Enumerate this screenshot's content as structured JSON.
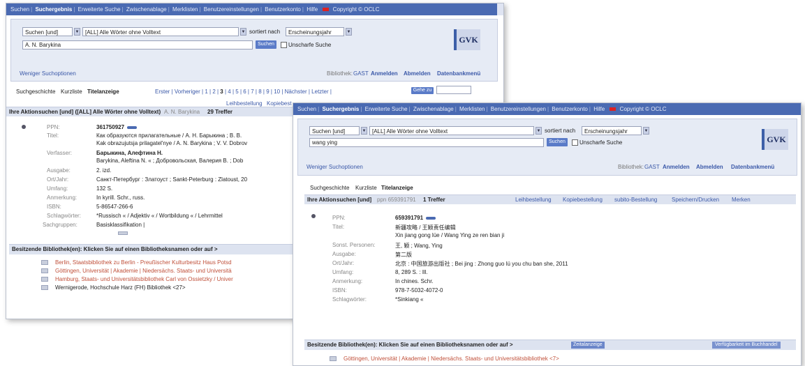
{
  "w1": {
    "nav": [
      "Suchen",
      "Suchergebnis",
      "Erweiterte Suche",
      "Zwischenablage",
      "Merklisten",
      "Benutzereinstellungen",
      "Benutzerkonto",
      "Hilfe"
    ],
    "copyright": "Copyright © OCLC",
    "search_mode": "Suchen [und]",
    "search_index": "[ALL] Alle Wörter ohne Volltext",
    "sort_label": "sortiert nach",
    "sort_value": "Erscheinungsjahr",
    "query": "A. N. Barykina",
    "search_button": "Suchen",
    "fuzzy_label": "Unscharfe Suche",
    "logo": "GVK",
    "fewer_options": "Weniger Suchoptionen",
    "library_label": "Bibliothek:",
    "library_value": "GAST",
    "login": "Anmelden",
    "logout": "Abmelden",
    "db_menu": "Datenbankmenü",
    "tab_history": "Suchgeschichte",
    "tab_short": "Kurzliste",
    "tab_title": "Titelanzeige",
    "pager_first": "Erster",
    "pager_prev": "Vorheriger",
    "pages": [
      "1",
      "2",
      "3",
      "4",
      "5",
      "6",
      "7",
      "8",
      "9",
      "10"
    ],
    "pager_next": "Nächster",
    "pager_last": "Letzter",
    "goto_button": "Gehe zu",
    "loan_order": "Leihbestellung",
    "copy_order": "Kopiebest",
    "action_label": "Ihre Aktion",
    "action_text": "suchen [und] ([ALL] Alle Wörter ohne Volltext)",
    "action_query": "A. N. Barykina",
    "hits": "29 Treffer",
    "fields": [
      {
        "label": "PPN:",
        "value": "361750927"
      },
      {
        "label": "Titel:",
        "value": "Как образуются прилагательные / А. Н. Барыкина ; В. В."
      },
      {
        "label": "",
        "value": "Kak obrazujutsja prilagatel'nye / A. N. Barykina ; V. V. Dobrov"
      },
      {
        "label": "Verfasser:",
        "value": "Барыкина, Алефтина Н."
      },
      {
        "label": "",
        "value": "Barykina, Aleftina N. « ; Добровольская, Валерия В. ; Dob"
      },
      {
        "label": "Ausgabe:",
        "value": "2. izd."
      },
      {
        "label": "Ort/Jahr:",
        "value": "Санкт-Петербург : Златоуст ; Sankt-Peterburg : Zlatoust, 20"
      },
      {
        "label": "Umfang:",
        "value": "132 S."
      },
      {
        "label": "Anmerkung:",
        "value": "In kyrill. Schr., russ."
      },
      {
        "label": "ISBN:",
        "value": "5-86547-266-6"
      },
      {
        "label": "Schlagwörter:",
        "value": "*Russisch « / Adjektiv « / Wortbildung « / Lehrmittel"
      },
      {
        "label": "Sachgruppen:",
        "value": "Basisklassifikation |"
      }
    ],
    "holdings_title": "Besitzende Bibliothek(en): Klicken Sie auf einen Bibliotheksnamen oder auf >",
    "holdings": [
      "Berlin, Staatsbibliothek zu Berlin - Preußischer Kulturbesitz Haus Potsd",
      "Göttingen, Universität | Akademie | Niedersächs. Staats- und Universitä",
      "Hamburg, Staats- und Universitätsbibliothek Carl von Ossietzky / Univer",
      "Wernigerode, Hochschule Harz (FH) Bibliothek <27>"
    ]
  },
  "w2": {
    "nav": [
      "Suchen",
      "Suchergebnis",
      "Erweiterte Suche",
      "Zwischenablage",
      "Merklisten",
      "Benutzereinstellungen",
      "Benutzerkonto",
      "Hilfe"
    ],
    "copyright": "Copyright © OCLC",
    "search_mode": "Suchen [und]",
    "search_index": "[ALL] Alle Wörter ohne Volltext",
    "sort_label": "sortiert nach",
    "sort_value": "Erscheinungsjahr",
    "query": "wang ying",
    "search_button": "Suchen",
    "fuzzy_label": "Unscharfe Suche",
    "logo": "GVK",
    "fewer_options": "Weniger Suchoptionen",
    "library_label": "Bibliothek:",
    "library_value": "GAST",
    "login": "Anmelden",
    "logout": "Abmelden",
    "db_menu": "Datenbankmenü",
    "tab_history": "Suchgeschichte",
    "tab_short": "Kurzliste",
    "tab_title": "Titelanzeige",
    "action_label": "Ihre Aktion",
    "action_text": "suchen [und]",
    "action_query": "ppn 659391791",
    "hits": "1 Treffer",
    "actions": [
      "Leihbestellung",
      "Kopiebestellung",
      "subito-Bestellung",
      "Speichern/Drucken",
      "Merken"
    ],
    "fields": [
      {
        "label": "PPN:",
        "value": "659391791"
      },
      {
        "label": "Titel:",
        "value": "新疆攻略 / 王颖责任编辑"
      },
      {
        "label": "",
        "value": "Xin jiang gong lüe / Wang Ying ze ren bian ji"
      },
      {
        "label": "Sonst. Personen:",
        "value": "王, 颖 ; Wang, Ying"
      },
      {
        "label": "Ausgabe:",
        "value": "第二版"
      },
      {
        "label": "Ort/Jahr:",
        "value": "北京 : 中国旅游出版社 ; Bei jing : Zhong guo lü you chu ban she, 2011"
      },
      {
        "label": "Umfang:",
        "value": "8, 289 S. : Ill."
      },
      {
        "label": "Anmerkung:",
        "value": "In chines. Schr."
      },
      {
        "label": "ISBN:",
        "value": "978-7-5032-4072-0"
      },
      {
        "label": "Schlagwörter:",
        "value": "*Sinkiang «"
      }
    ],
    "holdings_title": "Besitzende Bibliothek(en): Klicken Sie auf einen Bibliotheksnamen oder auf >",
    "holdings_badge": "Zeitalanzeige",
    "availability": "Verfügbarkeit im Buchhandel",
    "holdings": [
      "Göttingen, Universität | Akademie | Niedersächs. Staats- und Universitätsbibliothek <7>"
    ]
  }
}
